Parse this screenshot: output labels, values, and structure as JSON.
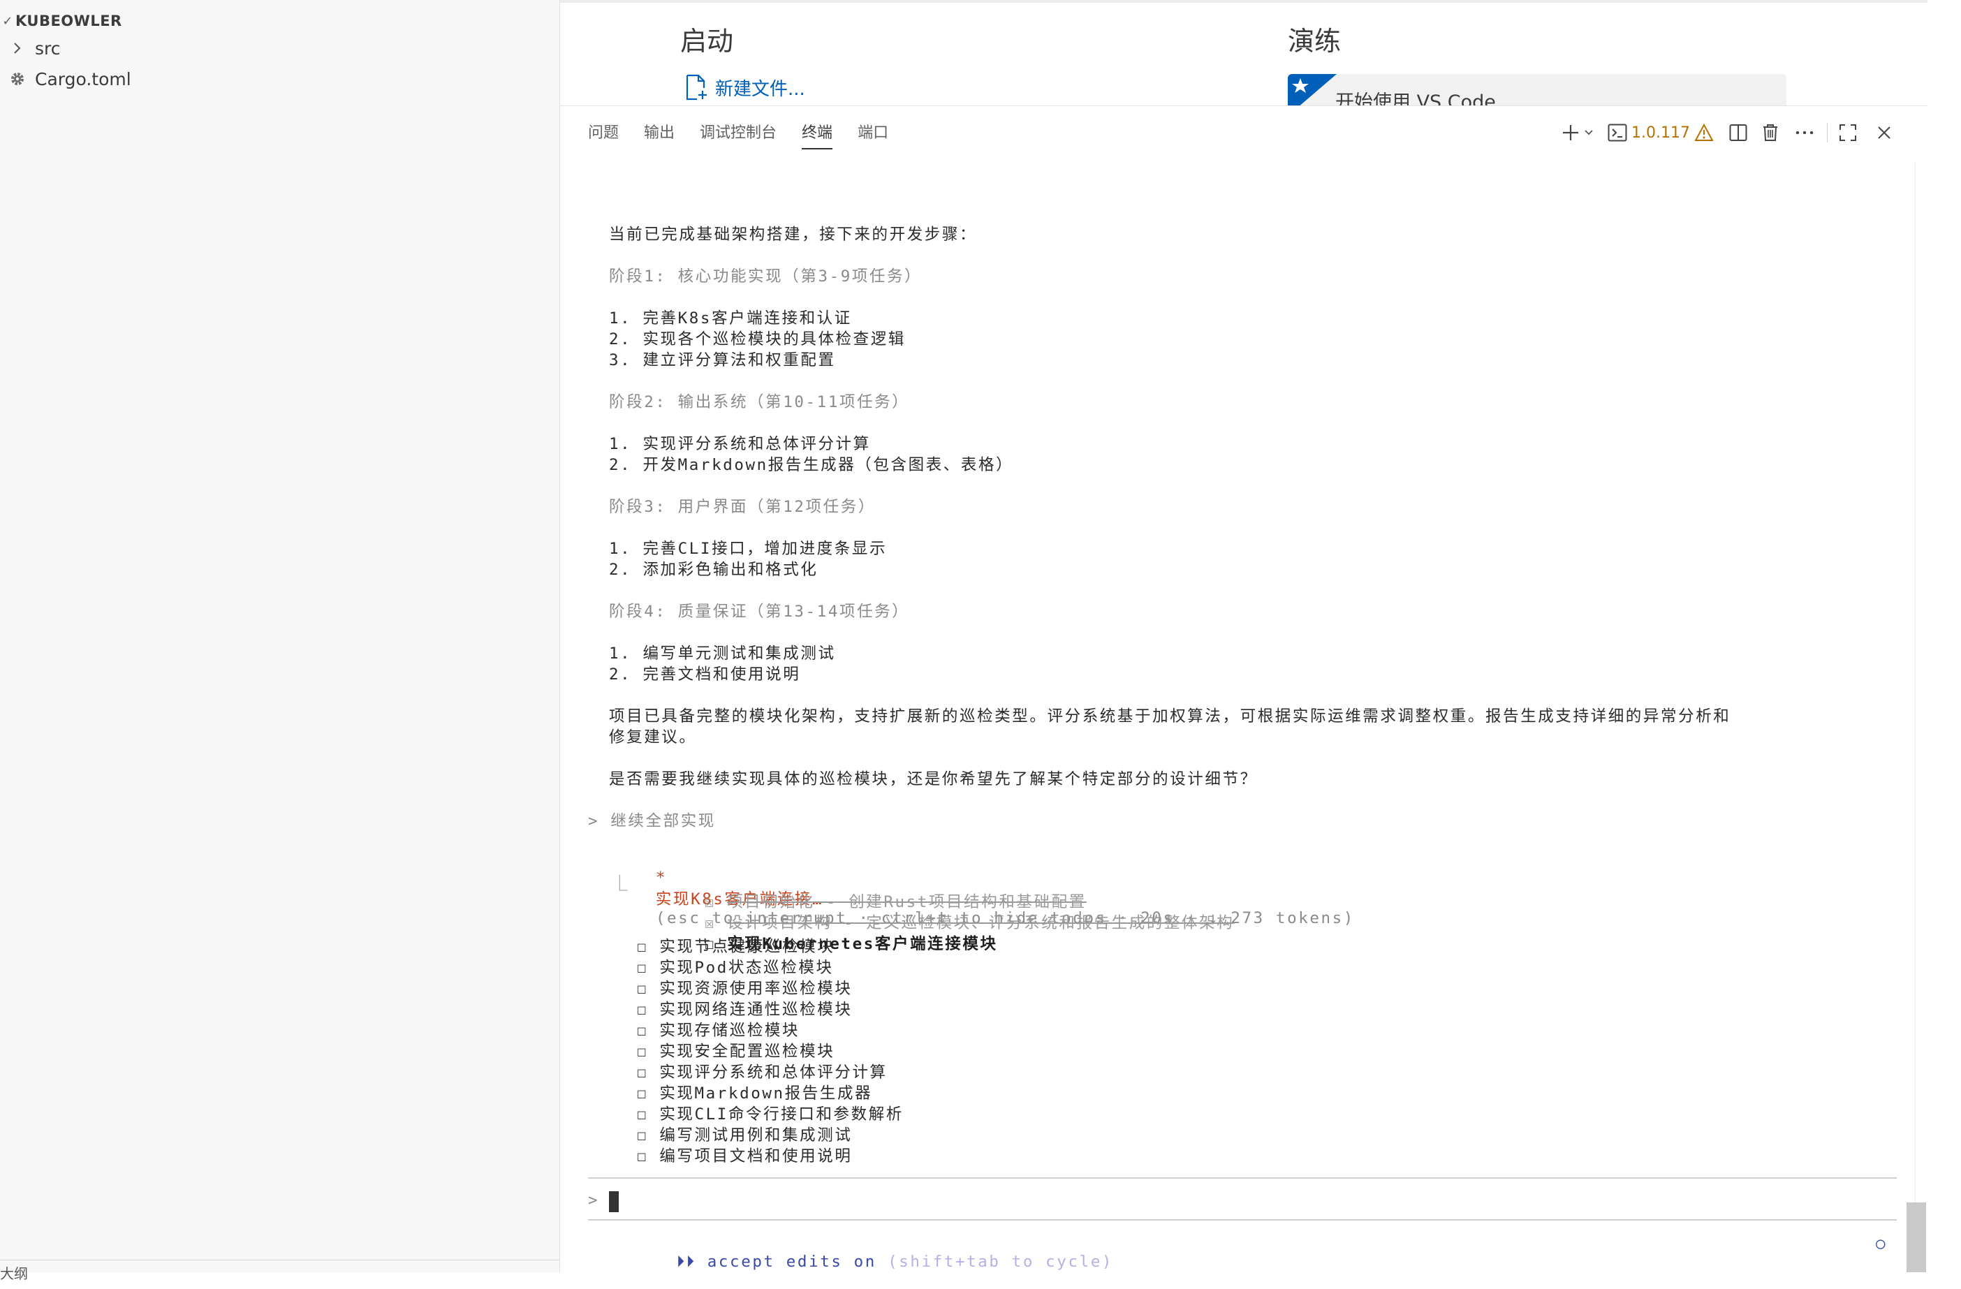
{
  "explorer": {
    "title": "KUBEOWLER",
    "items": [
      {
        "label": "src",
        "type": "folder"
      },
      {
        "label": "Cargo.toml",
        "type": "file"
      }
    ],
    "bottom_label": "大纲"
  },
  "welcome": {
    "start_heading": "启动",
    "new_file_link": "新建文件...",
    "walkthrough_heading": "演练",
    "walkthrough_card": "开始使用 VS Code"
  },
  "panel": {
    "tabs": [
      "问题",
      "输出",
      "调试控制台",
      "终端",
      "端口"
    ],
    "active_tab": "终端",
    "version": "1.0.117"
  },
  "terminal": {
    "intro": "当前已完成基础架构搭建，接下来的开发步骤：",
    "phases": [
      {
        "title": "阶段1: 核心功能实现（第3-9项任务）",
        "items": [
          "1. 完善K8s客户端连接和认证",
          "2. 实现各个巡检模块的具体检查逻辑",
          "3. 建立评分算法和权重配置"
        ]
      },
      {
        "title": "阶段2: 输出系统（第10-11项任务）",
        "items": [
          "1. 实现评分系统和总体评分计算",
          "2. 开发Markdown报告生成器（包含图表、表格）"
        ]
      },
      {
        "title": "阶段3: 用户界面（第12项任务）",
        "items": [
          "1. 完善CLI接口，增加进度条显示",
          "2. 添加彩色输出和格式化"
        ]
      },
      {
        "title": "阶段4: 质量保证（第13-14项任务）",
        "items": [
          "1. 编写单元测试和集成测试",
          "2. 完善文档和使用说明"
        ]
      }
    ],
    "summary_line1": "项目已具备完整的模块化架构，支持扩展新的巡检类型。评分系统基于加权算法，可根据实际运维需求调整权重。报告生成支持详细的异常分析和",
    "summary_line2": "修复建议。",
    "question": "是否需要我继续实现具体的巡检模块，还是你希望先了解某个特定部分的设计细节？",
    "user_prompt": "> 继续全部实现",
    "status_star": "*",
    "status_task": "实现K8s客户端连接…",
    "status_hint": "(esc to interrupt · ctrl+t to hide todos · 20s · ↓ 273 tokens)",
    "todo_connector": "⎿",
    "todos_done": [
      "项目初始化 - 创建Rust项目结构和基础配置",
      "设计项目架构 - 定义巡检模块、评分系统和报告生成的整体架构"
    ],
    "todo_current": "实现Kubernetes客户端连接模块",
    "todos_pending": [
      "实现节点健康巡检模块",
      "实现Pod状态巡检模块",
      "实现资源使用率巡检模块",
      "实现网络连通性巡检模块",
      "实现存储巡检模块",
      "实现安全配置巡检模块",
      "实现评分系统和总体评分计算",
      "实现Markdown报告生成器",
      "实现CLI命令行接口和参数解析",
      "编写测试用例和集成测试",
      "编写项目文档和使用说明"
    ],
    "checkbox_done": "☒",
    "checkbox_empty": "☐",
    "input_prompt": ">",
    "mode_arrows": "⏵⏵",
    "mode_text": "accept edits on",
    "mode_hint": "(shift+tab to cycle)",
    "mode_indicator": "○"
  },
  "colors": {
    "accent_blue": "#005fb8",
    "warning": "#b57200",
    "status_orange": "#c9441c",
    "mode_purple": "#3a4aa8"
  }
}
